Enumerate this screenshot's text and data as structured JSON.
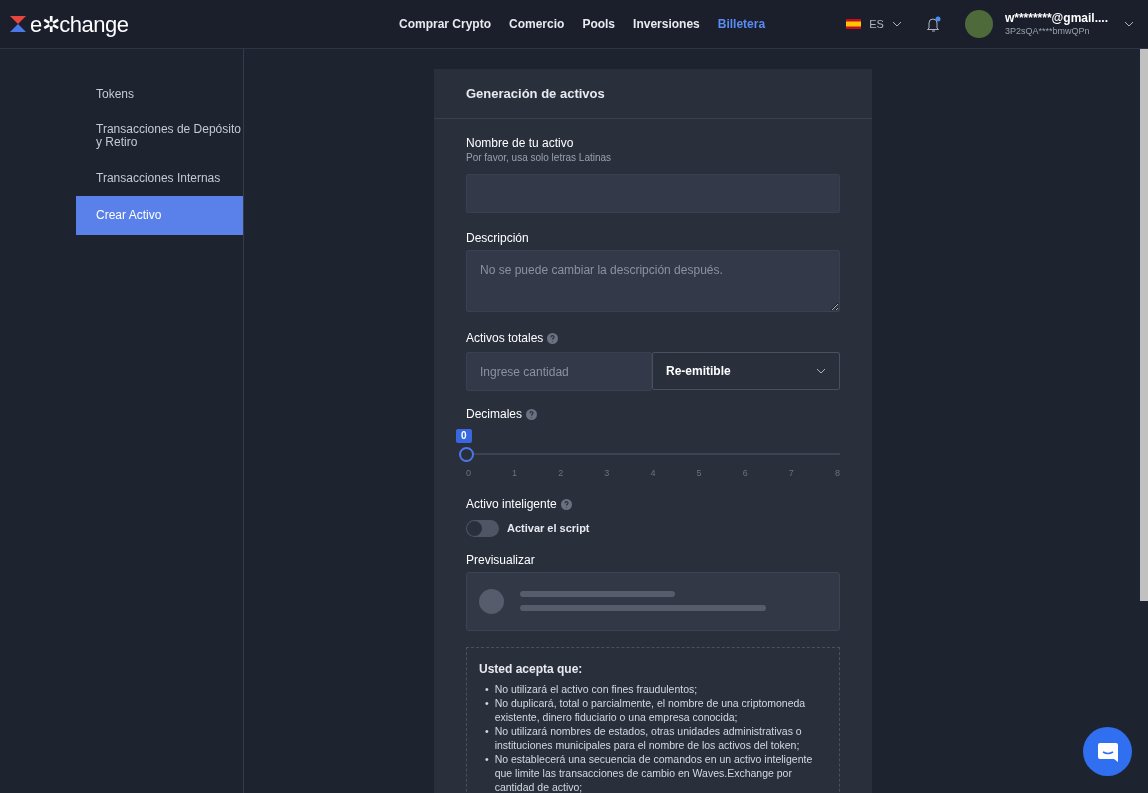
{
  "navbar": {
    "logo": "e✲change",
    "links": [
      {
        "label": "Comprar Crypto",
        "selected": false
      },
      {
        "label": "Comercio",
        "selected": false
      },
      {
        "label": "Pools",
        "selected": false
      },
      {
        "label": "Inversiones",
        "selected": false
      },
      {
        "label": "Billetera",
        "selected": true
      }
    ],
    "language": "ES",
    "notification_unread": true,
    "account": {
      "email": "w********@gmail....",
      "address": "3P2sQA****bmwQPn"
    }
  },
  "sidebar": {
    "items": [
      {
        "label": "Tokens",
        "selected": false
      },
      {
        "label": "Transacciones de Depósito y Retiro",
        "selected": false
      },
      {
        "label": "Transacciones Internas",
        "selected": false
      },
      {
        "label": "Crear Activo",
        "selected": true
      }
    ]
  },
  "form": {
    "title": "Generación de activos",
    "name": {
      "label": "Nombre de tu activo",
      "hint": "Por favor, usa solo letras Latinas"
    },
    "description": {
      "label": "Descripción",
      "placeholder": "No se puede cambiar la descripción después."
    },
    "total": {
      "label": "Activos totales",
      "placeholder": "Ingrese cantidad",
      "select": "Re-emitible"
    },
    "decimals": {
      "label": "Decimales",
      "value": "0",
      "level": 0,
      "ticks": [
        "0",
        "1",
        "2",
        "3",
        "4",
        "5",
        "6",
        "7",
        "8"
      ]
    },
    "smart": {
      "label": "Activo inteligente",
      "toggle_label": "Activar el script",
      "on": false
    },
    "preview": {
      "label": "Previsualizar"
    },
    "terms": {
      "title": "Usted acepta que:",
      "bullet": "•",
      "items": [
        "No utilizará el activo con fines fraudulentos;",
        "No duplicará, total o parcialmente, el nombre de una criptomoneda existente, dinero fiduciario o una empresa conocida;",
        "No utilizará nombres de estados, otras unidades administrativas o instituciones municipales para el nombre de los activos del token;",
        "No establecerá una secuencia de comandos en un activo inteligente que limite las transacciones de cambio en Waves.Exchange por cantidad de activo;"
      ]
    }
  }
}
